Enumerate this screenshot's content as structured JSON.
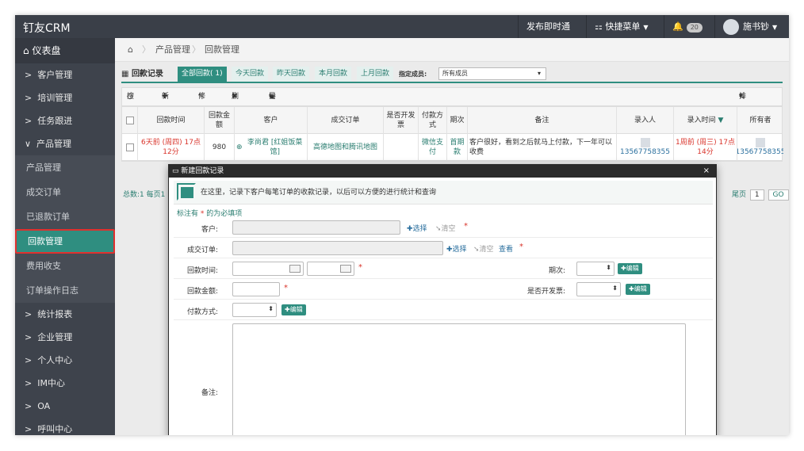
{
  "brand": "钉友CRM",
  "topbar": {
    "notify": "发布即时通知",
    "quick_menu": "快捷菜单",
    "bell_count": "20",
    "user_name": "施书钞"
  },
  "sidebar": {
    "dashboard": "仪表盘",
    "groups": [
      {
        "label": "客户管理"
      },
      {
        "label": "培训管理"
      },
      {
        "label": "任务跟进"
      },
      {
        "label": "产品管理"
      }
    ],
    "sub_items": [
      {
        "label": "产品管理"
      },
      {
        "label": "成交订单"
      },
      {
        "label": "已退款订单"
      },
      {
        "label": "回款管理"
      },
      {
        "label": "费用收支"
      },
      {
        "label": "订单操作日志"
      }
    ],
    "bottom_groups": [
      {
        "label": "统计报表"
      },
      {
        "label": "企业管理"
      },
      {
        "label": "个人中心"
      },
      {
        "label": "IM中心"
      },
      {
        "label": "OA"
      },
      {
        "label": "呼叫中心"
      }
    ]
  },
  "breadcrumb": {
    "level1": "产品管理",
    "level2": "回款管理"
  },
  "tabs": {
    "title": "回款记录",
    "items": [
      {
        "label": "全部回款( 1)"
      },
      {
        "label": "今天回款"
      },
      {
        "label": "昨天回款"
      },
      {
        "label": "本月回款"
      },
      {
        "label": "上月回款"
      }
    ],
    "member_label": "指定成员:",
    "member_value": "所有成员"
  },
  "toolbar": {
    "search": "搜索",
    "new": "新建",
    "edit": "修改",
    "delete": "删除",
    "export": "导出",
    "sort": "排序"
  },
  "table": {
    "headers": [
      "回款时间",
      "回款金额",
      "客户",
      "成交订单",
      "是否开发票",
      "付款方式",
      "期次",
      "备注",
      "录入人",
      "录入时间",
      "所有者"
    ],
    "row": {
      "time": "6天前 (周四) 17点12分",
      "amount": "980",
      "customer": "李尚君 [红姐饭菜馆]",
      "order": "高德地图和腾讯地图",
      "invoice": "",
      "pay_method": "微信支付",
      "term": "首期款",
      "remark": "客户很好，看到之后就马上付款，下一年可以收费",
      "creator": "13567758355",
      "created_at": "1周前 (周三) 17点14分",
      "owner": "13567758355"
    }
  },
  "pager": {
    "summary": "总数:1 每页1",
    "last": "尾页",
    "page": "1",
    "go": "GO"
  },
  "modal": {
    "title": "新建回款记录",
    "close": "×",
    "info": "在这里，记录下客户每笔订单的收款记录，以后可以方便的进行统计和查询",
    "required_prefix": "标注有",
    "required_star": "*",
    "required_suffix": "的为必填项",
    "fields": {
      "customer": "客户:",
      "order": "成交订单:",
      "time": "回款时间:",
      "term": "期次:",
      "amount": "回款金额:",
      "invoice": "是否开发票:",
      "pay_method": "付款方式:",
      "remark": "备注:"
    },
    "select_link": "选择",
    "clear_link": "清空",
    "view_link": "查看",
    "edit_btn": "编辑",
    "star": "*"
  }
}
